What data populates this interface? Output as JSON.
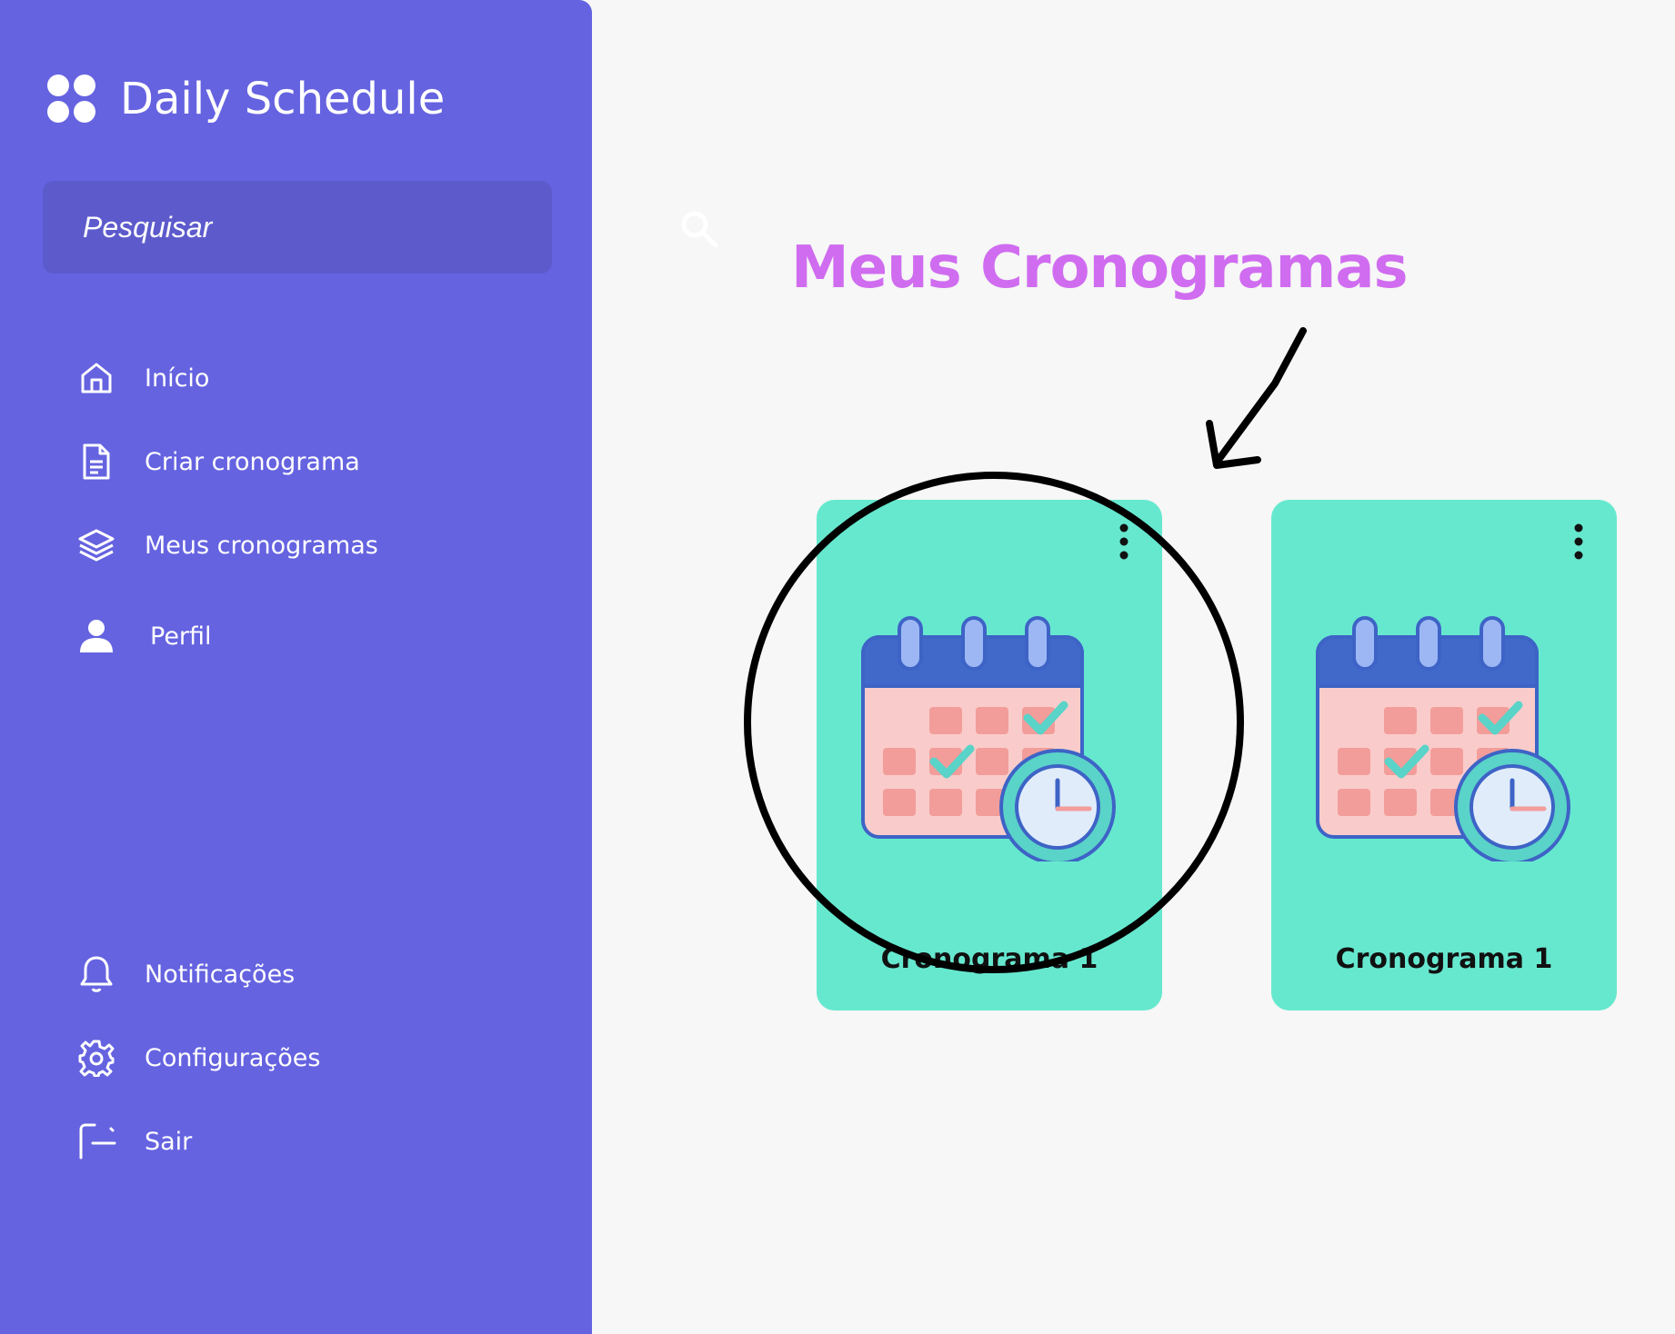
{
  "app": {
    "title": "Daily Schedule"
  },
  "sidebar": {
    "search_placeholder": "Pesquisar",
    "nav_items": [
      {
        "label": "Início",
        "icon": "home-icon"
      },
      {
        "label": "Criar cronograma",
        "icon": "document-icon"
      },
      {
        "label": "Meus cronogramas",
        "icon": "layers-icon"
      },
      {
        "label": "Perfil",
        "icon": "user-icon"
      }
    ],
    "bottom_items": [
      {
        "label": "Notificações",
        "icon": "bell-icon"
      },
      {
        "label": "Configurações",
        "icon": "gear-icon"
      },
      {
        "label": "Sair",
        "icon": "logout-icon"
      }
    ]
  },
  "main": {
    "title": "Meus Cronogramas",
    "cards": [
      {
        "label": "Cronograma 1"
      },
      {
        "label": "Cronograma 1"
      }
    ]
  },
  "colors": {
    "sidebar": "#6563e0",
    "search_box": "#5d5bcc",
    "background": "#f6f7f6",
    "title": "#d06cf0",
    "card": "#66e8cf"
  }
}
